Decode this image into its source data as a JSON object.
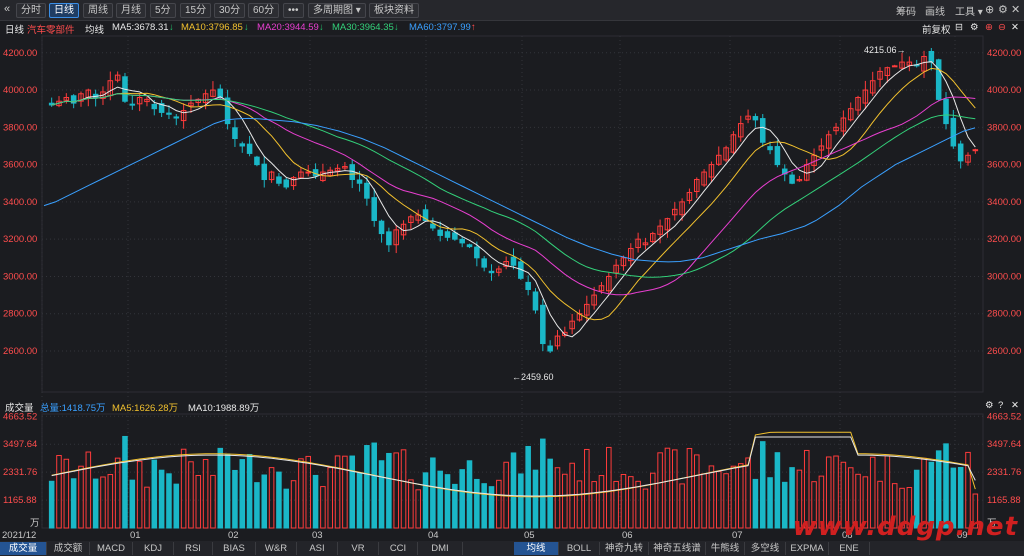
{
  "toolbar": {
    "back_icon": "«",
    "items": [
      "分时",
      "日线",
      "周线",
      "月线",
      "5分",
      "15分",
      "30分",
      "60分",
      "•••",
      "多周期图 ▾",
      "板块资料"
    ],
    "active": "日线",
    "right": [
      "筹码",
      "画线",
      "工具 ▾"
    ]
  },
  "info": {
    "period": "日线",
    "name": "汽车零部件",
    "ma_label": "均线",
    "ma5": "MA5:3678.31",
    "ma10": "MA10:3796.85",
    "ma20": "MA20:3944.59",
    "ma30": "MA30:3964.35",
    "ma60": "MA60:3797.99",
    "fq": "前复权"
  },
  "volume_info": {
    "label": "成交量",
    "total": "总量:1418.75万",
    "ma5": "MA5:1626.28万",
    "ma10": "MA10:1988.89万"
  },
  "annotations": {
    "high": "4215.06",
    "low": "2459.60"
  },
  "x_labels": [
    "2021/12",
    "01",
    "02",
    "03",
    "04",
    "05",
    "06",
    "07",
    "08",
    "09"
  ],
  "tabs_left": [
    "成交量",
    "成交额",
    "MACD",
    "KDJ",
    "RSI",
    "BIAS",
    "W&R",
    "ASI",
    "VR",
    "CCI",
    "DMI"
  ],
  "tabs_right": [
    "均线",
    "BOLL",
    "神奇九转",
    "神奇五线谱",
    "牛熊线",
    "多空线",
    "EXPMA",
    "ENE"
  ],
  "watermark": "www.ddgp.net",
  "colors": {
    "up": "#ff3b3b",
    "down": "#1ab7c7",
    "ma5": "#e8e8e8",
    "ma10": "#f2c12e",
    "ma20": "#e83fd0",
    "ma30": "#33d17a",
    "ma60": "#3aa0ff",
    "grid": "#33343a"
  },
  "chart_data": [
    {
      "type": "candlestick",
      "title": "",
      "y_ticks": [
        "4200.00",
        "4000.00",
        "3800.00",
        "3600.00",
        "3400.00",
        "3200.00",
        "3000.00",
        "2800.00",
        "2600.00"
      ],
      "ylim": [
        2380,
        4290
      ],
      "x_ticks": [
        "2021/12",
        "01",
        "02",
        "03",
        "04",
        "05",
        "06",
        "07",
        "08",
        "09"
      ],
      "series": [
        {
          "name": "MA5",
          "color": "#e8e8e8"
        },
        {
          "name": "MA10",
          "color": "#f2c12e"
        },
        {
          "name": "MA20",
          "color": "#e83fd0"
        },
        {
          "name": "MA30",
          "color": "#33d17a"
        },
        {
          "name": "MA60",
          "color": "#3aa0ff"
        }
      ],
      "ma60_path": [
        3380,
        3400,
        3430,
        3460,
        3490,
        3520,
        3550,
        3580,
        3610,
        3640,
        3670,
        3700,
        3730,
        3760,
        3790,
        3820,
        3840,
        3845,
        3848,
        3845,
        3840,
        3835,
        3830,
        3820,
        3810,
        3795,
        3780,
        3760,
        3740,
        3715,
        3690,
        3660,
        3630,
        3600,
        3570,
        3540,
        3510,
        3480,
        3450,
        3420,
        3390,
        3360,
        3330,
        3300,
        3270,
        3240,
        3210,
        3185,
        3160,
        3140,
        3120,
        3105,
        3090,
        3085,
        3080,
        3078,
        3080,
        3090,
        3100,
        3120,
        3140,
        3160,
        3180,
        3200,
        3215,
        3230,
        3250,
        3270,
        3300,
        3340,
        3380,
        3430,
        3480,
        3520,
        3560,
        3600,
        3630,
        3660,
        3690,
        3720,
        3750,
        3780,
        3797
      ],
      "close": [
        3920,
        3940,
        3960,
        3930,
        3980,
        4000,
        3960,
        3990,
        4050,
        4080,
        3940,
        3920,
        3960,
        3950,
        3900,
        3880,
        3870,
        3850,
        3890,
        3930,
        3950,
        3980,
        4000,
        3960,
        3820,
        3740,
        3700,
        3660,
        3600,
        3520,
        3560,
        3500,
        3480,
        3530,
        3560,
        3560,
        3540,
        3560,
        3570,
        3580,
        3590,
        3520,
        3500,
        3420,
        3300,
        3230,
        3170,
        3250,
        3280,
        3320,
        3330,
        3300,
        3260,
        3220,
        3210,
        3200,
        3180,
        3160,
        3100,
        3050,
        3020,
        3040,
        3080,
        3060,
        2990,
        2930,
        2820,
        2640,
        2600,
        2680,
        2700,
        2760,
        2800,
        2850,
        2900,
        2950,
        3000,
        3060,
        3100,
        3150,
        3200,
        3180,
        3230,
        3270,
        3310,
        3360,
        3400,
        3450,
        3520,
        3560,
        3600,
        3650,
        3690,
        3760,
        3820,
        3860,
        3840,
        3720,
        3680,
        3600,
        3550,
        3500,
        3520,
        3600,
        3650,
        3700,
        3760,
        3800,
        3850,
        3900,
        3960,
        4000,
        4050,
        4100,
        4120,
        4130,
        4150,
        4150,
        4130,
        4180,
        4150,
        3950,
        3820,
        3700,
        3620,
        3650,
        3680
      ],
      "volume_ticks": [
        "4663.52",
        "3497.64",
        "2331.76",
        "1165.88",
        "万"
      ],
      "volume_ylim": [
        0,
        4760
      ],
      "volume_last": 1418.75,
      "volume_ma5_last": 1626.28,
      "volume_ma10_last": 1988.89,
      "last_ma5": 3678.31,
      "last_ma10": 3796.85,
      "last_ma20": 3944.59,
      "last_ma30": 3964.35,
      "last_ma60": 3797.99,
      "high": 4215.06,
      "low": 2459.6
    }
  ]
}
